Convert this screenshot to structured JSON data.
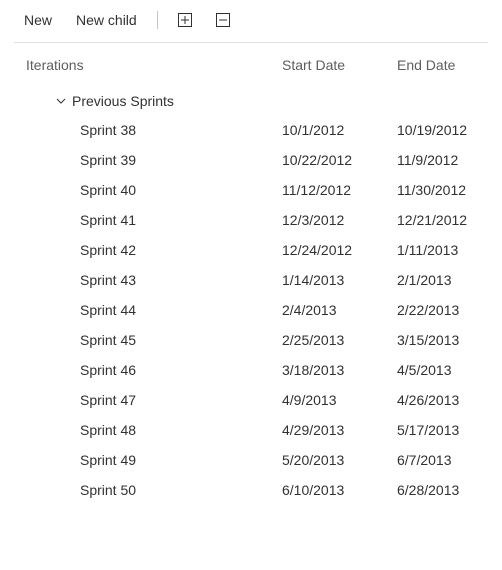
{
  "toolbar": {
    "new_label": "New",
    "new_child_label": "New child"
  },
  "columns": {
    "iterations": "Iterations",
    "start_date": "Start Date",
    "end_date": "End Date"
  },
  "group": {
    "label": "Previous Sprints"
  },
  "sprints": [
    {
      "name": "Sprint 38",
      "start": "10/1/2012",
      "end": "10/19/2012"
    },
    {
      "name": "Sprint 39",
      "start": "10/22/2012",
      "end": "11/9/2012"
    },
    {
      "name": "Sprint 40",
      "start": "11/12/2012",
      "end": "11/30/2012"
    },
    {
      "name": "Sprint 41",
      "start": "12/3/2012",
      "end": "12/21/2012"
    },
    {
      "name": "Sprint 42",
      "start": "12/24/2012",
      "end": "1/11/2013"
    },
    {
      "name": "Sprint 43",
      "start": "1/14/2013",
      "end": "2/1/2013"
    },
    {
      "name": "Sprint 44",
      "start": "2/4/2013",
      "end": "2/22/2013"
    },
    {
      "name": "Sprint 45",
      "start": "2/25/2013",
      "end": "3/15/2013"
    },
    {
      "name": "Sprint 46",
      "start": "3/18/2013",
      "end": "4/5/2013"
    },
    {
      "name": "Sprint 47",
      "start": "4/9/2013",
      "end": "4/26/2013"
    },
    {
      "name": "Sprint 48",
      "start": "4/29/2013",
      "end": "5/17/2013"
    },
    {
      "name": "Sprint 49",
      "start": "5/20/2013",
      "end": "6/7/2013"
    },
    {
      "name": "Sprint 50",
      "start": "6/10/2013",
      "end": "6/28/2013"
    }
  ]
}
